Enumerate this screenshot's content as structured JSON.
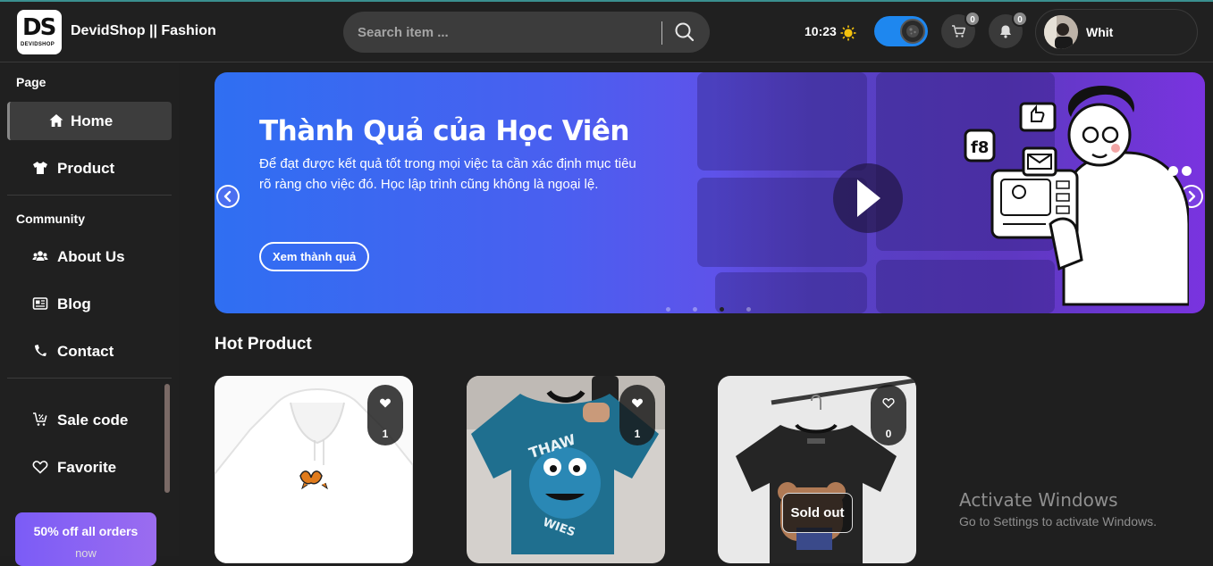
{
  "header": {
    "logo_text": "DS",
    "logo_subtext": "DEVIDSHOP",
    "brand": "DevidShop || Fashion",
    "search_placeholder": "Search item ...",
    "time": "10:23",
    "cart_count": "0",
    "notification_count": "0",
    "user_name": "Whit"
  },
  "sidebar": {
    "section_page": "Page",
    "section_community": "Community",
    "items": [
      {
        "label": "Home",
        "icon": "home-icon",
        "active": true
      },
      {
        "label": "Product",
        "icon": "tshirt-icon"
      },
      {
        "label": "About Us",
        "icon": "users-icon"
      },
      {
        "label": "Blog",
        "icon": "newspaper-icon"
      },
      {
        "label": "Contact",
        "icon": "phone-icon"
      },
      {
        "label": "Sale code",
        "icon": "cart-percent-icon"
      },
      {
        "label": "Favorite",
        "icon": "heart-icon"
      }
    ],
    "promo_line1": "50% off all orders",
    "promo_line2": "now"
  },
  "banner": {
    "title": "Thành Quả của Học Viên",
    "description": "Để đạt được kết quả tốt trong mọi việc ta cần xác định mục tiêu rõ ràng cho việc đó. Học lập trình cũng không là ngoại lệ.",
    "cta": "Xem thành quả",
    "slide_count": 4,
    "active_slide": 3
  },
  "hot_product": {
    "title": "Hot Product",
    "products": [
      {
        "like_count": "1",
        "image": "white hoodie with butterfly",
        "sold_out": false
      },
      {
        "like_count": "1",
        "image": "teal cookie monster tee",
        "sold_out": false
      },
      {
        "like_count": "0",
        "image": "black bear graphic tee",
        "sold_out": true,
        "sold_out_label": "Sold out"
      }
    ]
  },
  "watermark": {
    "line1": "Activate Windows",
    "line2": "Go to Settings to activate Windows."
  },
  "colors": {
    "accent": "#1e87ef",
    "banner_start": "#2f6ff2",
    "banner_end": "#7a36e0",
    "promo": "#8b64f3"
  }
}
